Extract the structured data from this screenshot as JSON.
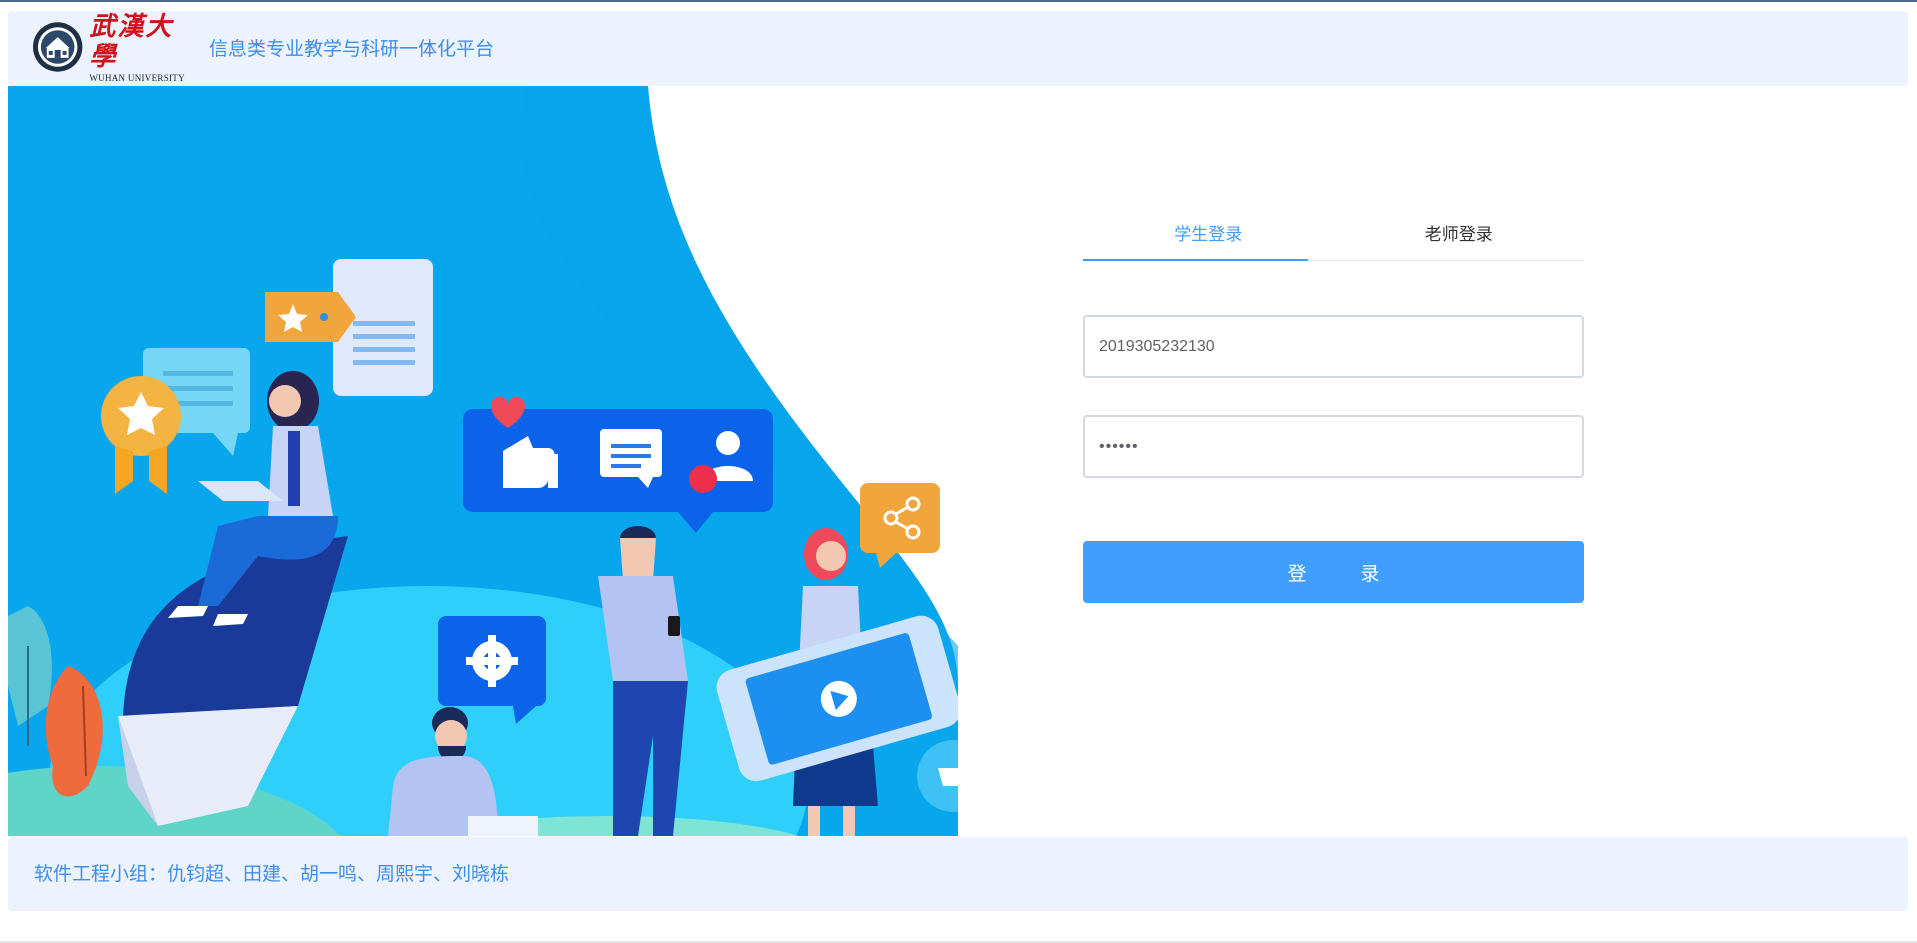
{
  "header": {
    "logo": {
      "cn_name": "武漢大學",
      "en_name": "WUHAN UNIVERSITY",
      "seal_icon": "university-seal-icon"
    },
    "title": "信息类专业教学与科研一体化平台"
  },
  "login": {
    "tabs": [
      {
        "label": "学生登录",
        "active": true
      },
      {
        "label": "老师登录",
        "active": false
      }
    ],
    "username_value": "2019305232130",
    "password_value": "••••••",
    "submit_label": "登 录"
  },
  "footer": {
    "text": "软件工程小组：仇钧超、田建、胡一鸣、周熙宇、刘晓栋"
  },
  "colors": {
    "accent": "#409eff",
    "header_bg": "#ecf3fe",
    "brand_red": "#d0121b",
    "title_blue": "#3d8ee8"
  }
}
